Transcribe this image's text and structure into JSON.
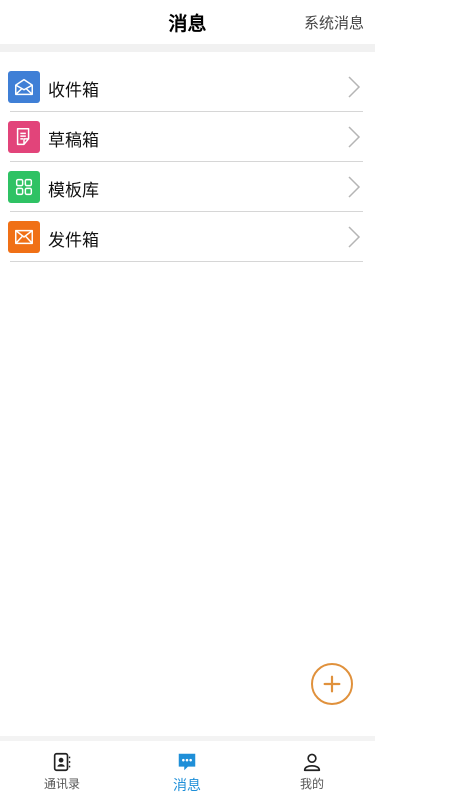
{
  "header": {
    "title": "消息",
    "system_messages_label": "系统消息"
  },
  "menu": {
    "items": [
      {
        "label": "收件箱",
        "icon": "inbox-icon",
        "color": "#3f7fd6"
      },
      {
        "label": "草稿箱",
        "icon": "draft-icon",
        "color": "#e2447a"
      },
      {
        "label": "模板库",
        "icon": "template-grid-icon",
        "color": "#2fc264"
      },
      {
        "label": "发件箱",
        "icon": "outbox-icon",
        "color": "#f07016"
      }
    ]
  },
  "fab": {
    "icon": "plus-icon",
    "color": "#e0913c"
  },
  "tabbar": {
    "tabs": [
      {
        "label": "通讯录",
        "icon": "contacts-icon",
        "active": false
      },
      {
        "label": "消息",
        "icon": "chat-bubble-icon",
        "active": true
      },
      {
        "label": "我的",
        "icon": "person-icon",
        "active": false
      }
    ],
    "active_color": "#1f8fd8"
  }
}
